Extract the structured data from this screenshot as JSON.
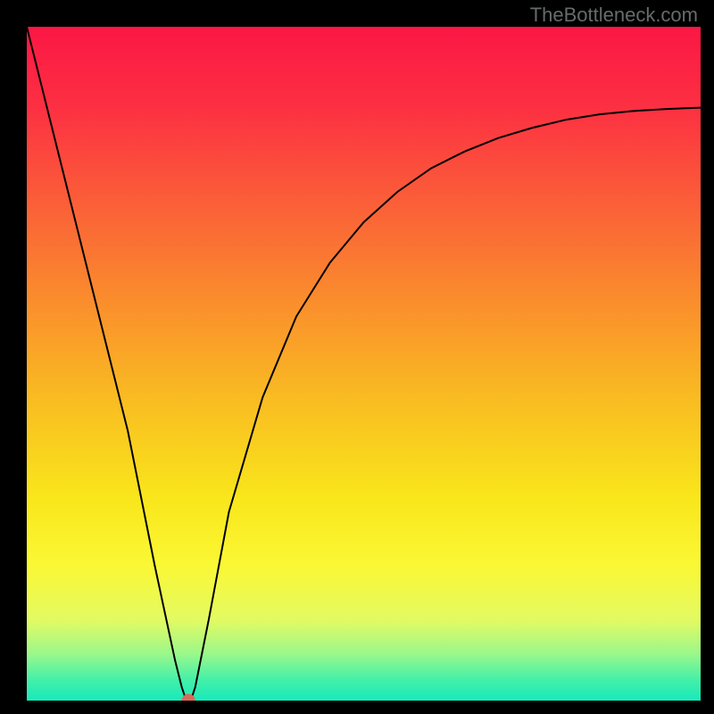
{
  "watermark": "TheBottleneck.com",
  "chart_data": {
    "type": "line",
    "title": "",
    "xlabel": "",
    "ylabel": "",
    "xlim": [
      0,
      100
    ],
    "ylim": [
      0,
      100
    ],
    "series": [
      {
        "name": "bottleneck-curve",
        "x": [
          0,
          5,
          10,
          15,
          19,
          22,
          23,
          23.5,
          24,
          24.5,
          25,
          27,
          30,
          35,
          40,
          45,
          50,
          55,
          60,
          65,
          70,
          75,
          80,
          85,
          90,
          95,
          100
        ],
        "values": [
          100,
          80,
          60,
          40,
          20,
          6,
          2,
          0.5,
          0,
          0.5,
          2,
          12,
          28,
          45,
          57,
          65,
          71,
          75.5,
          79,
          81.5,
          83.5,
          85,
          86.2,
          87,
          87.5,
          87.8,
          88
        ]
      }
    ],
    "marker": {
      "x": 24,
      "y": 0,
      "color": "#d86a5a"
    },
    "gradient_stops": [
      {
        "offset": 0.0,
        "color": "#fb1745"
      },
      {
        "offset": 0.12,
        "color": "#fc3042"
      },
      {
        "offset": 0.25,
        "color": "#fb5b39"
      },
      {
        "offset": 0.4,
        "color": "#fa8b2d"
      },
      {
        "offset": 0.55,
        "color": "#f9bb22"
      },
      {
        "offset": 0.7,
        "color": "#f9e61b"
      },
      {
        "offset": 0.8,
        "color": "#faf835"
      },
      {
        "offset": 0.88,
        "color": "#e3fa62"
      },
      {
        "offset": 0.93,
        "color": "#9cf88a"
      },
      {
        "offset": 0.97,
        "color": "#42f0a9"
      },
      {
        "offset": 1.0,
        "color": "#17e9bb"
      }
    ]
  }
}
